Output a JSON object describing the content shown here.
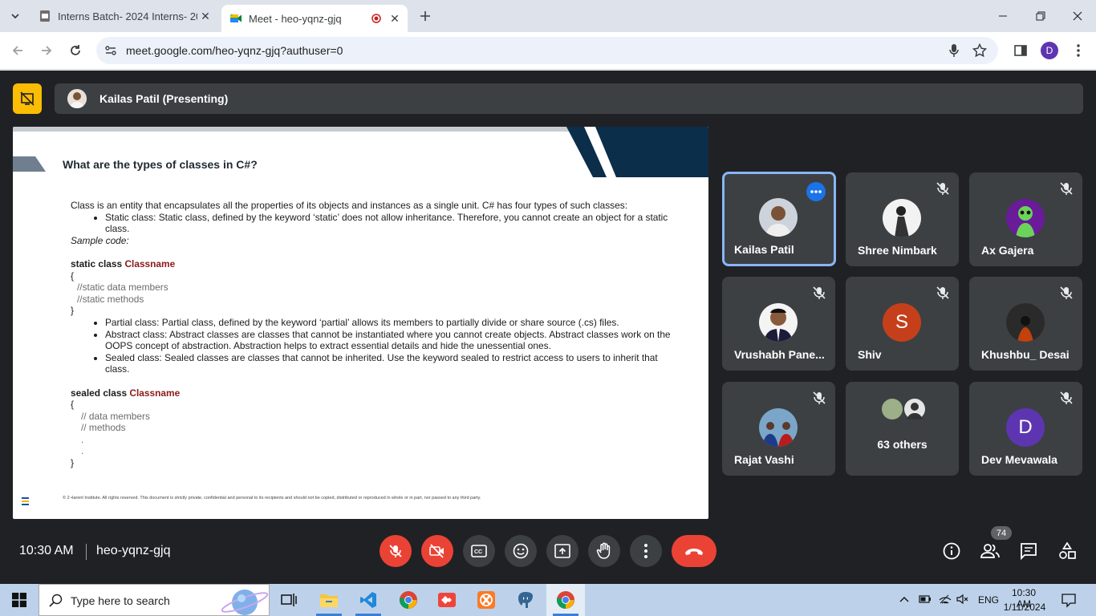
{
  "browser": {
    "tabs": [
      {
        "title": "Interns Batch- 2024 Interns- 20...",
        "active": false
      },
      {
        "title": "Meet - heo-yqnz-gjq",
        "active": true
      }
    ],
    "url": "meet.google.com/heo-yqnz-gjq?authuser=0",
    "profile_initial": "D"
  },
  "meet": {
    "presenter_label": "Kailas Patil (Presenting)",
    "slide": {
      "title": "What are the types of classes in C#?",
      "intro": "Class is an entity that encapsulates all the properties of its objects and instances as a single unit. C# has four types of such classes:",
      "bullet_static": "Static class: Static class, defined by the keyword ‘static’ does not allow inheritance. Therefore, you cannot create an object for a static class.",
      "sample_code_label": "Sample code:",
      "code1_kw": "static class",
      "code1_name": "Classname",
      "code1_open": "{",
      "code1_line1": "//static data members",
      "code1_line2": "//static methods",
      "code1_close": "}",
      "bullet_partial": "Partial class: Partial class, defined by the keyword ‘partial’ allows its members to partially divide or share source (.cs) files.",
      "bullet_abstract": "Abstract class: Abstract classes are classes that cannot be instantiated where you cannot create objects. Abstract classes work on the OOPS concept of abstraction. Abstraction helps to extract essential details and hide the unessential ones.",
      "bullet_sealed": "Sealed class: Sealed classes are classes that cannot be inherited. Use the keyword sealed to restrict access to users to inherit that class.",
      "code2_kw": "sealed class",
      "code2_name": "Classname",
      "code2_open": "{",
      "code2_line1": "// data members",
      "code2_line2": "// methods",
      "code2_dot": ".",
      "code2_close": "}",
      "footer": "© 2   •larent Institute. All rights reserved. This document is strictly private, confidential and personal to its recipients and should not be copied, distributed or reproduced in whole or in part, nor passed to any third party."
    },
    "participants": [
      {
        "name": "Kailas Patil"
      },
      {
        "name": "Shree Nimbark"
      },
      {
        "name": "Ax Gajera"
      },
      {
        "name": "Vrushabh Pane..."
      },
      {
        "name": "Shiv",
        "initial": "S"
      },
      {
        "name": "Khushbu_ Desai"
      },
      {
        "name": "Rajat Vashi"
      },
      {
        "name": "63 others"
      },
      {
        "name": "Dev Mevawala",
        "initial": "D"
      }
    ],
    "colors": {
      "shiv_avatar": "#c5401a",
      "dev_avatar": "#5e35b1",
      "red_button": "#ea4335",
      "active_tile_border": "#8ab4f8"
    },
    "time": "10:30 AM",
    "meeting_code": "heo-yqnz-gjq",
    "people_count": "74"
  },
  "taskbar": {
    "search_placeholder": "Type here to search",
    "language": "ENG",
    "time": "10:30 AM",
    "date": "1/11/2024"
  }
}
